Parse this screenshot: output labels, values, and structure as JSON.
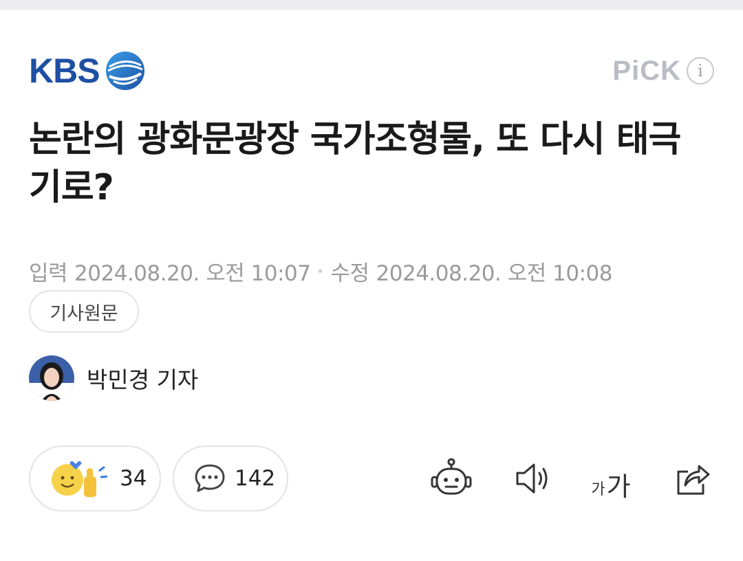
{
  "header": {
    "logo_text": "KBS",
    "pick_label": "PiCK",
    "info_glyph": "i",
    "brand_color": "#1d4fa3"
  },
  "article": {
    "headline": "논란의 광화문광장 국가조형물, 또 다시 태극기로?",
    "input_label": "입력",
    "input_time": "2024.08.20. 오전 10:07",
    "modified_label": "수정",
    "modified_time": "2024.08.20. 오전 10:08",
    "origin_button": "기사원문"
  },
  "reporter": {
    "name": "박민경 기자"
  },
  "actions": {
    "reaction_count": "34",
    "comment_count": "142"
  },
  "icons": {
    "reaction": "emoji-reaction-icon",
    "comment": "comment-bubble-icon",
    "summary_bot": "robot-icon",
    "tts": "speaker-icon",
    "font_size_small": "가",
    "font_size_big": "가",
    "share": "share-icon"
  }
}
